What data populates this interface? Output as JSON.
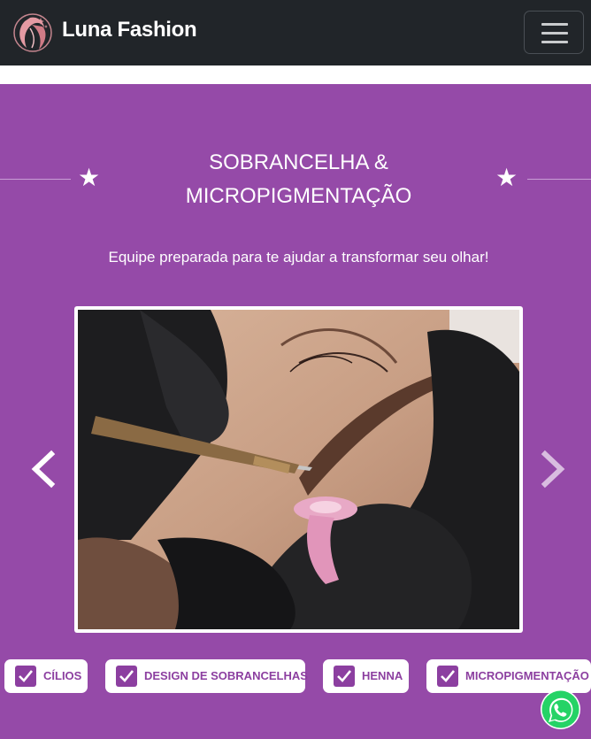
{
  "navbar": {
    "brand": "Luna Fashion",
    "logo_icon": "woman-face-logo-icon",
    "menu_icon": "hamburger-menu-icon"
  },
  "hero": {
    "title_line1": "SOBRANCELHA &",
    "title_line2": "MICROPIGMENTAÇÃO",
    "subtitle": "Equipe preparada para te ajudar a transformar seu olhar!",
    "decor_icon": "star-icon"
  },
  "carousel": {
    "image_alt": "micropigmentation-procedure-photo",
    "prev_icon": "chevron-left-icon",
    "next_icon": "chevron-right-icon"
  },
  "services": [
    {
      "label": "CÍLIOS"
    },
    {
      "label": "DESIGN DE SOBRANCELHAS"
    },
    {
      "label": "HENNA"
    },
    {
      "label": "MICROPIGMENTAÇÃO"
    }
  ],
  "floating": {
    "whatsapp_icon": "whatsapp-icon"
  },
  "colors": {
    "navbar_bg": "#212529",
    "section_bg": "#954aa8",
    "accent": "#8c3fa0",
    "whatsapp_green": "#25d366"
  }
}
